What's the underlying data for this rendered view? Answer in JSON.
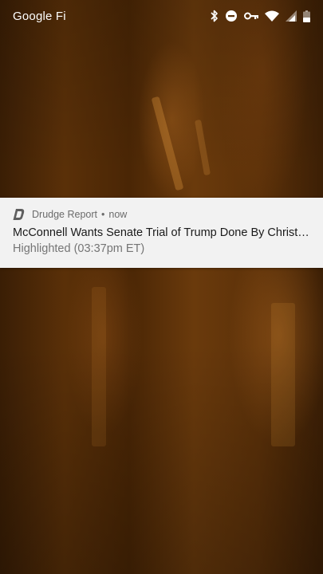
{
  "status_bar": {
    "carrier": "Google Fi",
    "icons": [
      "bluetooth-icon",
      "do-not-disturb-icon",
      "vpn-key-icon",
      "wifi-icon",
      "cell-signal-icon",
      "battery-icon"
    ],
    "icon_color": "#ffffff"
  },
  "notification": {
    "app_name": "Drudge Report",
    "separator": "•",
    "time": "now",
    "title": "McConnell Wants Senate Trial of Trump Done By Christmas...",
    "text": "Highlighted (03:37pm ET)",
    "app_icon": "drudge-report-icon",
    "background": "#f2f2f2"
  },
  "wallpaper": {
    "colors": [
      "#3a1e05",
      "#6a3a0c",
      "#c8782a"
    ]
  }
}
